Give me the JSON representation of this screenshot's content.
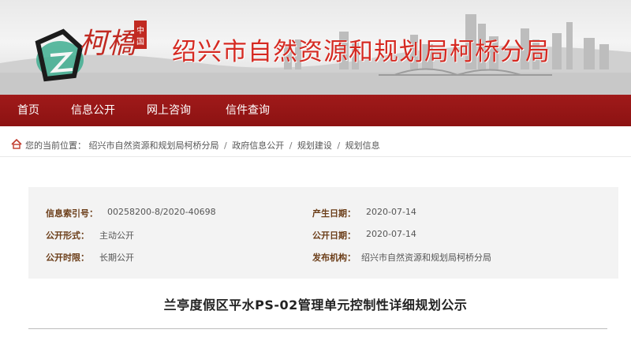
{
  "header": {
    "logo_text": "柯橋",
    "logo_seal": "中国",
    "site_title": "绍兴市自然资源和规划局柯桥分局"
  },
  "nav": {
    "items": [
      {
        "label": "首页"
      },
      {
        "label": "信息公开"
      },
      {
        "label": "网上咨询"
      },
      {
        "label": "信件查询"
      }
    ]
  },
  "breadcrumb": {
    "prefix": "您的当前位置：",
    "items": [
      "绍兴市自然资源和规划局柯桥分局",
      "政府信息公开",
      "规划建设",
      "规划信息"
    ],
    "separator": "/"
  },
  "info": {
    "index_label": "信息索引号：",
    "index_value": "00258200-8/2020-40698",
    "gen_date_label": "产生日期：",
    "gen_date_value": "2020-07-14",
    "form_label": "公开形式：",
    "form_value": "主动公开",
    "pub_date_label": "公开日期：",
    "pub_date_value": "2020-07-14",
    "limit_label": "公开时限：",
    "limit_value": "长期公开",
    "org_label": "发布机构：",
    "org_value": "绍兴市自然资源和规划局柯桥分局"
  },
  "article": {
    "title": "兰亭度假区平水PS-02管理单元控制性详细规划公示"
  },
  "colors": {
    "nav_bg": "#9a1818",
    "title_red": "#d52a22",
    "label_brown": "#6b3d18"
  },
  "icons": {
    "home": "home-icon"
  }
}
